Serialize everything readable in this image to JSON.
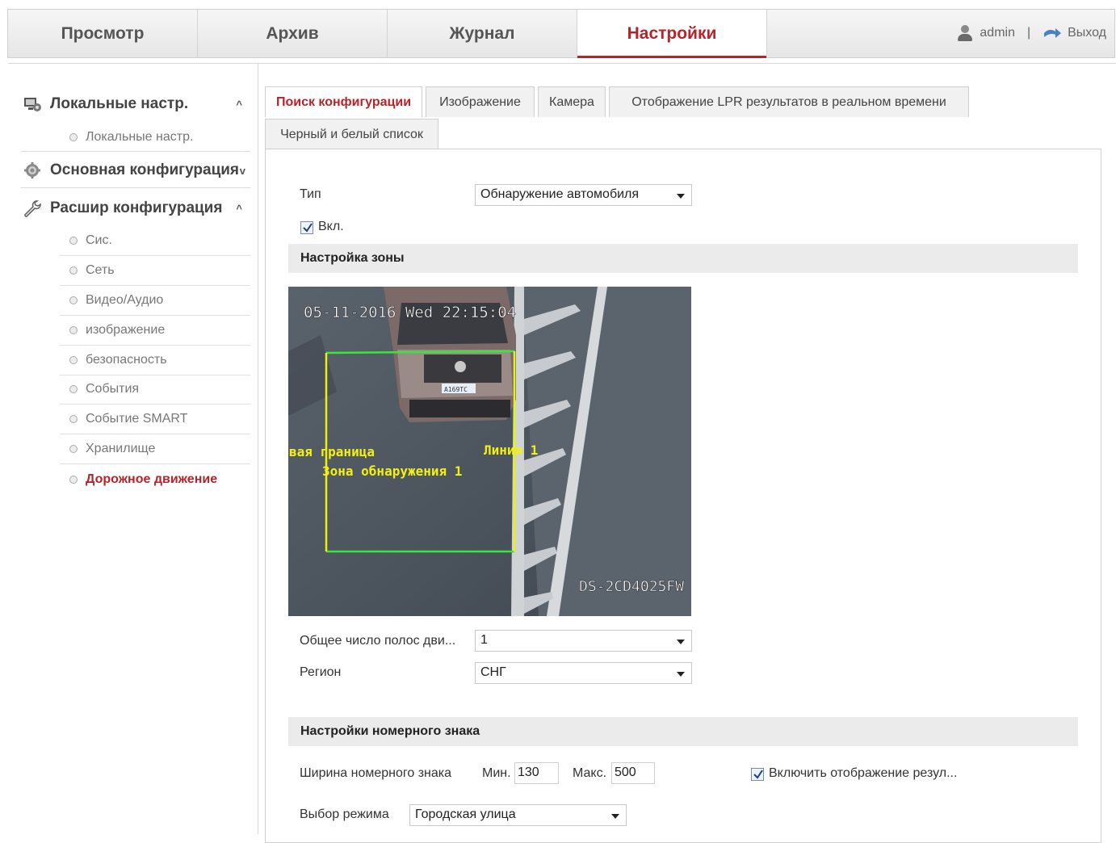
{
  "nav": {
    "tabs": [
      "Просмотр",
      "Архив",
      "Журнал",
      "Настройки"
    ],
    "user": "admin",
    "separator": "|",
    "logout": "Выход"
  },
  "sidebar": {
    "groups": [
      {
        "label": "Локальные настр.",
        "caret": "^",
        "icon": "monitor-icon"
      },
      {
        "label": "Основная конфигурация",
        "caret": "v",
        "icon": "gear-icon"
      },
      {
        "label": "Расшир конфигурация",
        "caret": "^",
        "icon": "wrench-icon"
      }
    ],
    "local_items": [
      "Локальные настр."
    ],
    "adv_items": [
      "Сис.",
      "Сеть",
      "Видео/Аудио",
      "изображение",
      "безопасность",
      "События",
      "Событие SMART",
      "Хранилище",
      "Дорожное движение"
    ],
    "active_item": "Дорожное движение"
  },
  "tabs": [
    "Поиск конфигурации",
    "Изображение",
    "Камера",
    "Отображение LPR результатов в реальном времени",
    "Черный и белый список"
  ],
  "form": {
    "type_label": "Тип",
    "type_value": "Обнаружение автомобиля",
    "enable_label": "Вкл.",
    "enable_checked": true,
    "zone_section": "Настройка зоны",
    "lanes_label": "Общее число полос дви...",
    "lanes_value": "1",
    "region_label": "Регион",
    "region_value": "СНГ",
    "plate_section": "Настройки номерного знака",
    "plate_width_label": "Ширина номерного знака",
    "min_label": "Мин.",
    "min_value": "130",
    "max_label": "Макс.",
    "max_value": "500",
    "show_result_label": "Включить отображение резул...",
    "show_result_checked": true,
    "mode_label": "Выбор режима",
    "mode_value": "Городская улица"
  },
  "video": {
    "timestamp": "05-11-2016 Wed 22:15:04",
    "camera_model": "DS-2CD4025FW",
    "boundary_label": "вая граница",
    "line_label": "Линия 1",
    "zone_label": "Зона обнаружения 1",
    "plate_text": "А169ТС"
  },
  "colors": {
    "accent": "#b5242b",
    "zone_line": "#39e63a",
    "boundary_line": "#e7f20d",
    "overlay_text": "#f5f10e"
  }
}
